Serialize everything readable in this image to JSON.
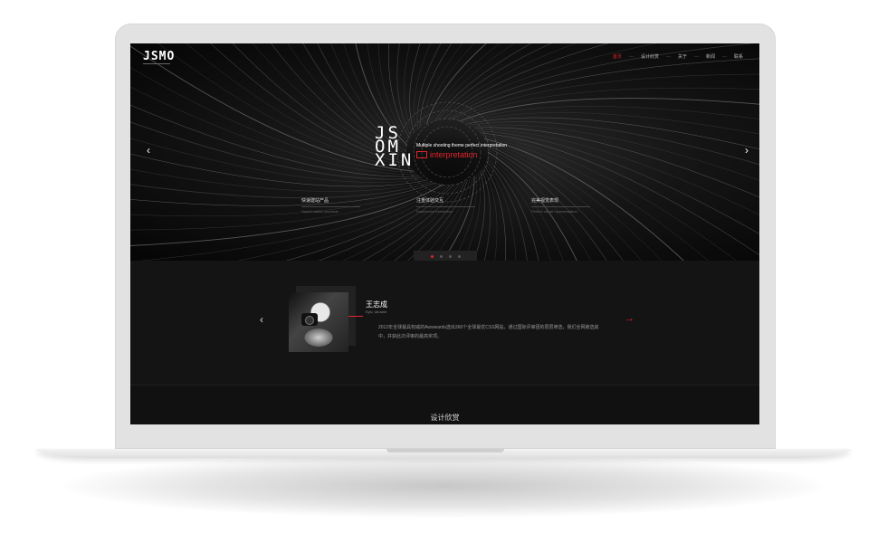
{
  "site": {
    "logo": "JSMO"
  },
  "nav": {
    "items": [
      {
        "label": "首页",
        "active": true
      },
      {
        "label": "设计欣赏",
        "active": false
      },
      {
        "label": "关于",
        "active": false
      },
      {
        "label": "新闻",
        "active": false
      },
      {
        "label": "联系",
        "active": false
      }
    ]
  },
  "hero": {
    "title_lines": [
      "JS",
      "OM",
      "XIN"
    ],
    "tagline": "Multiple shooting theme perfect interpretation",
    "red_text": "interpretation",
    "features": [
      {
        "zh": "快速建站产品",
        "en": "Speed station products"
      },
      {
        "zh": "注重体验交互",
        "en": "Experience Interaction"
      },
      {
        "zh": "完美视觉表现",
        "en": "Perfect visual representation"
      }
    ],
    "pager": {
      "count": 4,
      "active_index": 0
    }
  },
  "testimonial": {
    "name": "王志成",
    "location": "Kyiv, Ukraine",
    "text": "2012年全球最具权威的Awwwards选出360个全球最优CSS网站，通过国际评审团的层层筛选，我们全网被选其中，并获此次评审的最高奖项。"
  },
  "section": {
    "title": "设计欣赏"
  },
  "colors": {
    "accent": "#e3242b",
    "background": "#0a0a0a",
    "panel": "#141414"
  }
}
